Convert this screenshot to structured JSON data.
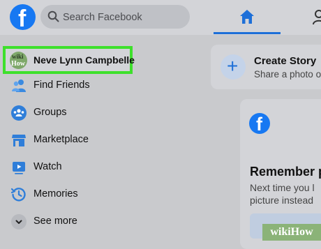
{
  "header": {
    "logo_letter": "f",
    "search": {
      "placeholder": "Search Facebook"
    }
  },
  "sidebar": {
    "profile": {
      "name": "Neve Lynn Campbelle",
      "avatar_text_top": "wiki",
      "avatar_text_bottom": "How"
    },
    "items": [
      {
        "label": "Find Friends",
        "icon": "friends-icon"
      },
      {
        "label": "Groups",
        "icon": "groups-icon"
      },
      {
        "label": "Marketplace",
        "icon": "marketplace-icon"
      },
      {
        "label": "Watch",
        "icon": "watch-icon"
      },
      {
        "label": "Memories",
        "icon": "memories-icon"
      },
      {
        "label": "See more",
        "icon": "chevron-down-icon"
      }
    ]
  },
  "main": {
    "create_story": {
      "title": "Create Story",
      "subtitle": "Share a photo or",
      "plus": "+"
    },
    "card": {
      "logo_letter": "f",
      "heading": "Remember p",
      "line1": "Next time you l",
      "line2": "picture instead"
    }
  },
  "watermark": "wikiHow",
  "colors": {
    "brand": "#1778f2",
    "highlight": "#3ee02c",
    "nav_active": "#1d6fd8"
  }
}
